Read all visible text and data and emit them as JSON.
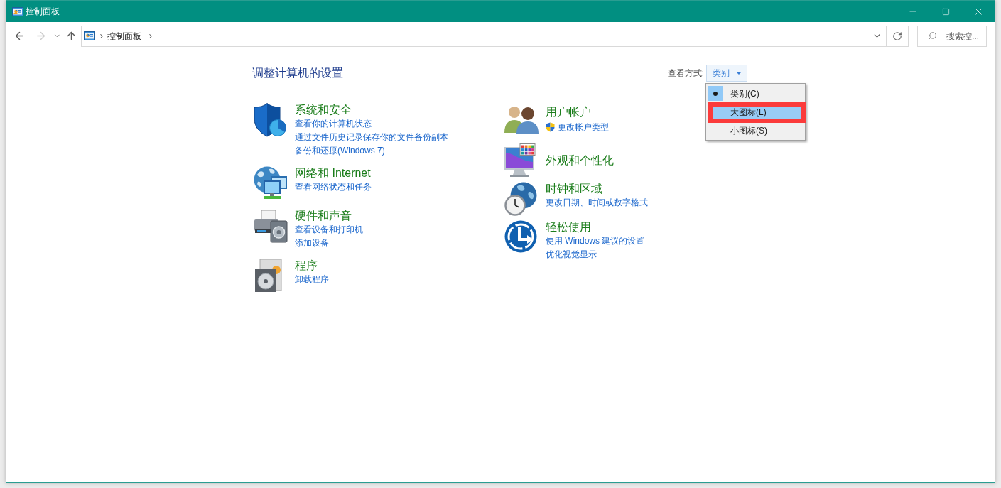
{
  "window": {
    "title": "控制面板"
  },
  "navigation": [
    {
      "kind": "back",
      "disabled": false
    },
    {
      "kind": "forward",
      "disabled": true
    },
    {
      "kind": "recent",
      "disabled": false
    },
    {
      "kind": "up",
      "disabled": false
    }
  ],
  "address_bar": {
    "path": [
      "控制面板"
    ]
  },
  "search": {
    "placeholder": "搜索控..."
  },
  "heading": "调整计算机的设置",
  "view_by": {
    "label": "查看方式:",
    "value": "类别",
    "open": true,
    "menu": [
      {
        "label": "类别(C)",
        "selected": true,
        "highlighted": false,
        "outlined": false
      },
      {
        "label": "大图标(L)",
        "selected": false,
        "highlighted": true,
        "outlined": true
      },
      {
        "label": "小图标(S)",
        "selected": false,
        "highlighted": false,
        "outlined": false
      }
    ]
  },
  "categories": {
    "left": [
      {
        "title": "系统和安全",
        "links": [
          {
            "text": "查看你的计算机状态",
            "kind": "plain"
          },
          {
            "text": "通过文件历史记录保存你的文件备份副本",
            "kind": "plain"
          },
          {
            "text": "备份和还原(Windows 7)",
            "kind": "plain"
          }
        ]
      },
      {
        "title": "网络和 Internet",
        "links": [
          {
            "text": "查看网络状态和任务",
            "kind": "plain"
          }
        ]
      },
      {
        "title": "硬件和声音",
        "links": [
          {
            "text": "查看设备和打印机",
            "kind": "plain"
          },
          {
            "text": "添加设备",
            "kind": "plain"
          }
        ]
      },
      {
        "title": "程序",
        "links": [
          {
            "text": "卸载程序",
            "kind": "plain"
          }
        ]
      }
    ],
    "right": [
      {
        "title": "用户帐户",
        "links": [
          {
            "text": "更改帐户类型",
            "kind": "uac"
          }
        ]
      },
      {
        "title": "外观和个性化"
      },
      {
        "title": "时钟和区域",
        "links": [
          {
            "text": "更改日期、时间或数字格式",
            "kind": "plain"
          }
        ]
      },
      {
        "title": "轻松使用",
        "links": [
          {
            "text": "使用 Windows 建议的设置",
            "kind": "plain"
          },
          {
            "text": "优化视觉显示",
            "kind": "plain"
          }
        ]
      }
    ]
  }
}
